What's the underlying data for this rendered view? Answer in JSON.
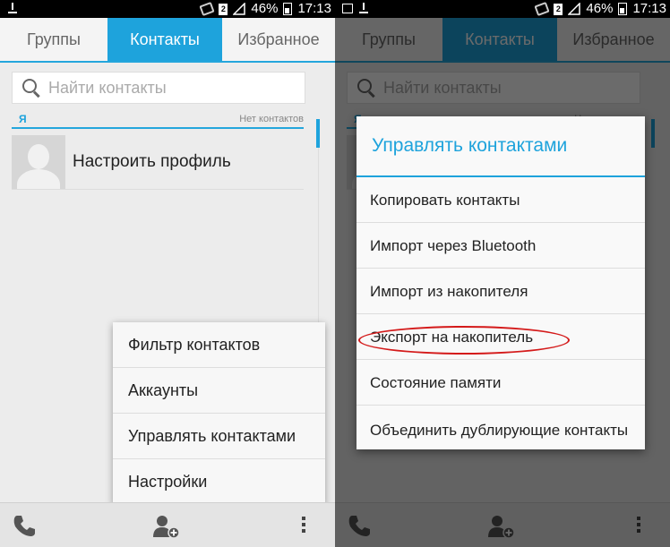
{
  "status_bar": {
    "battery_percent": "46%",
    "time": "17:13",
    "sim_label": "2"
  },
  "tabs": [
    {
      "label": "Группы"
    },
    {
      "label": "Контакты"
    },
    {
      "label": "Избранное"
    }
  ],
  "search": {
    "placeholder": "Найти контакты"
  },
  "section": {
    "letter": "Я",
    "count_text": "Нет контактов"
  },
  "profile": {
    "label": "Настроить профиль"
  },
  "overflow_menu": {
    "items": [
      {
        "label": "Фильтр контактов"
      },
      {
        "label": "Аккаунты"
      },
      {
        "label": "Управлять контактами"
      },
      {
        "label": "Настройки"
      }
    ]
  },
  "manage_dialog": {
    "title": "Управлять контактами",
    "items": [
      {
        "label": "Копировать контакты"
      },
      {
        "label": "Импорт через Bluetooth"
      },
      {
        "label": "Импорт из накопителя"
      },
      {
        "label": "Экспорт на накопитель"
      },
      {
        "label": "Состояние памяти"
      },
      {
        "label": "Объединить дублирующие контакты"
      }
    ],
    "highlighted_item": "Экспорт на накопитель"
  },
  "colors": {
    "accent": "#1ea3dc",
    "highlight_ellipse": "#d41a1a"
  },
  "icons": {
    "search": "search-icon",
    "phone": "phone-icon",
    "add_contact": "add-contact-icon",
    "more": "more-vert-icon"
  }
}
